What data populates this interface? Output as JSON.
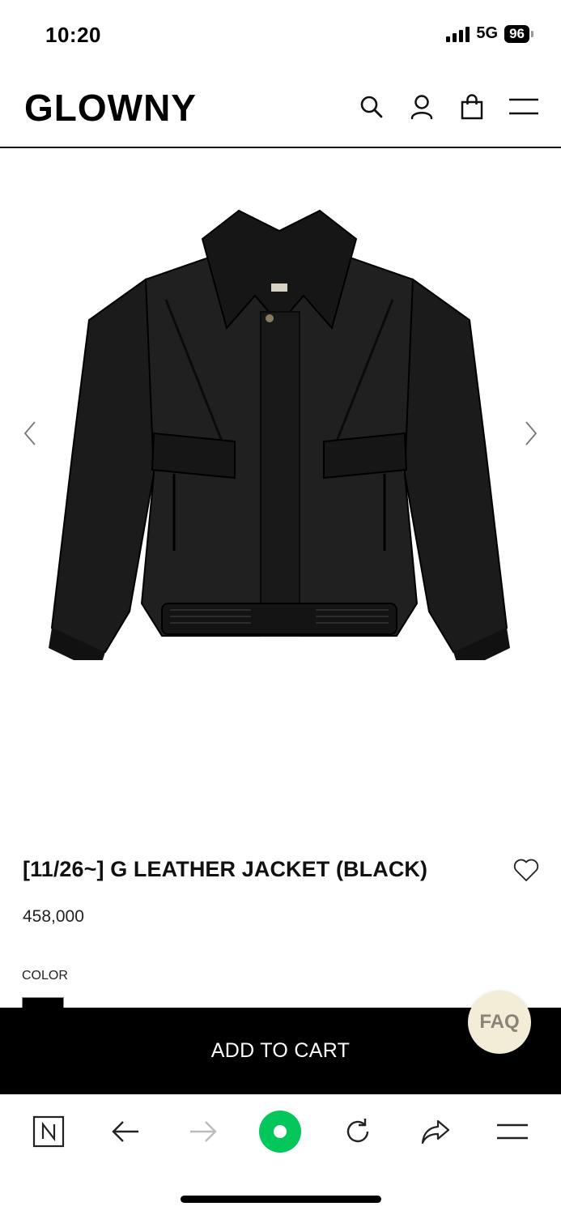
{
  "status_bar": {
    "time": "10:20",
    "network": "5G",
    "battery": "96"
  },
  "header": {
    "logo": "GLOWNY",
    "icons": [
      "search-icon",
      "account-icon",
      "shopping-bag-icon",
      "menu-icon"
    ]
  },
  "gallery": {
    "image_alt": "black leather jacket",
    "prev_icon": "chevron-left-icon",
    "next_icon": "chevron-right-icon"
  },
  "product": {
    "title": "[11/26~] G LEATHER JACKET (BLACK)",
    "price": "458,000",
    "color_label": "COLOR",
    "selected_color": "#000000",
    "wishlist_icon": "heart-icon"
  },
  "actions": {
    "add_to_cart": "ADD TO CART",
    "faq": "FAQ"
  },
  "browser_bar": {
    "icons": [
      "naver-n-icon",
      "back-arrow-icon",
      "forward-arrow-icon",
      "green-dot-icon",
      "reload-icon",
      "share-icon",
      "menu-icon"
    ],
    "accent": "#03c75a"
  }
}
